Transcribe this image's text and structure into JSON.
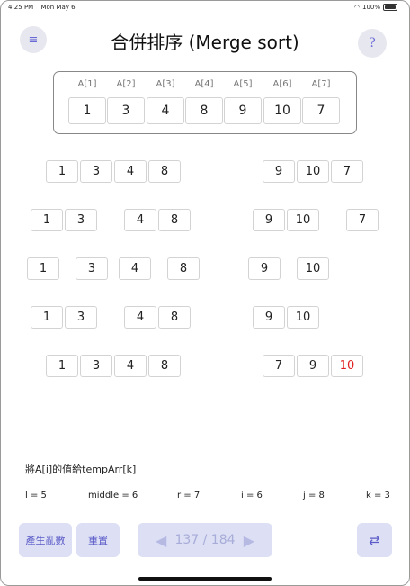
{
  "status": {
    "time": "4:25 PM",
    "date": "Mon May 6",
    "battery": "100%"
  },
  "header": {
    "title": "合併排序 (Merge sort)",
    "menu_icon": "≡",
    "help_icon": "?"
  },
  "array": {
    "indices": [
      "A[1]",
      "A[2]",
      "A[3]",
      "A[4]",
      "A[5]",
      "A[6]",
      "A[7]"
    ],
    "values": [
      "1",
      "3",
      "4",
      "8",
      "9",
      "10",
      "7"
    ]
  },
  "levels": [
    [
      "1",
      "3",
      "4",
      "8",
      "9",
      "10",
      "7"
    ],
    [
      "1",
      "3",
      "4",
      "8",
      "9",
      "10",
      "7"
    ],
    [
      "1",
      "3",
      "4",
      "8",
      "9",
      "10"
    ],
    [
      "1",
      "3",
      "4",
      "8",
      "9",
      "10"
    ],
    [
      "1",
      "3",
      "4",
      "8",
      "7",
      "9",
      "10"
    ]
  ],
  "highlight_color": "#e02020",
  "operation": "將A[i]的值給tempArr[k]",
  "vars": [
    "l = 5",
    "middle = 6",
    "r = 7",
    "i = 6",
    "j = 8",
    "k = 3"
  ],
  "toolbar": {
    "random_label": "產生亂數",
    "reset_label": "重置",
    "prev_icon": "◀",
    "progress": "137 / 184",
    "next_icon": "▶",
    "swap_icon": "⇄"
  }
}
